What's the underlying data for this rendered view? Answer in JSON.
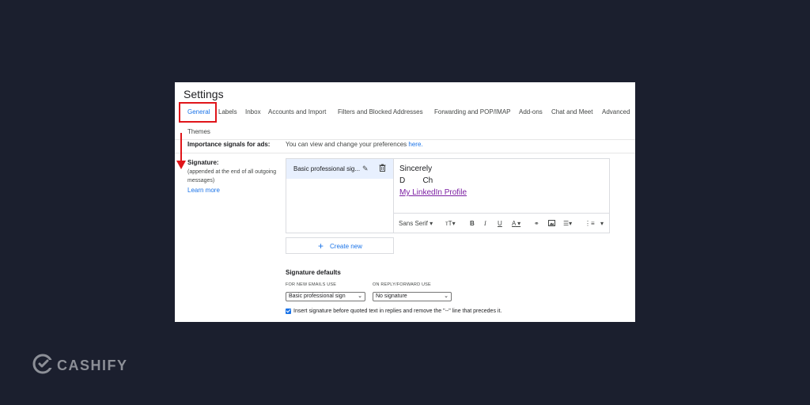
{
  "settings": {
    "title": "Settings",
    "tabs": [
      {
        "label": "General",
        "active": true
      },
      {
        "label": "Labels"
      },
      {
        "label": "Inbox"
      },
      {
        "label": "Accounts and Import"
      },
      {
        "label": "Filters and Blocked Addresses"
      },
      {
        "label": "Forwarding and POP/IMAP"
      },
      {
        "label": "Add-ons"
      },
      {
        "label": "Chat and Meet"
      },
      {
        "label": "Advanced"
      }
    ],
    "themes_label": "Themes",
    "importance": {
      "label": "Importance signals for ads:",
      "text": "You can view and change your preferences ",
      "link": "here."
    },
    "signature": {
      "label": "Signature:",
      "sub1": "(appended at the end of all outgoing",
      "sub2": "messages)",
      "learn_more": "Learn more",
      "list_item": "Basic professional sig...",
      "editor_lines": [
        "Sincerely",
        "D        Ch"
      ],
      "editor_link": "My LinkedIn Profile",
      "toolbar": {
        "font": "Sans Serif",
        "size": "тT",
        "bold": "B",
        "italic": "I",
        "underline": "U",
        "color": "A"
      },
      "create_new": "Create new"
    },
    "defaults": {
      "title": "Signature defaults",
      "new_label": "FOR NEW EMAILS USE",
      "new_value": "Basic professional sign",
      "reply_label": "ON REPLY/FORWARD USE",
      "reply_value": "No signature",
      "checkbox_checked": true,
      "checkbox_label": "Insert signature before quoted text in replies and remove the \"--\" line that precedes it."
    }
  },
  "brand": {
    "name": "CASHIFY"
  },
  "colors": {
    "accent": "#1a73e8",
    "highlight": "#e0151a",
    "background": "#1b1f2e"
  }
}
